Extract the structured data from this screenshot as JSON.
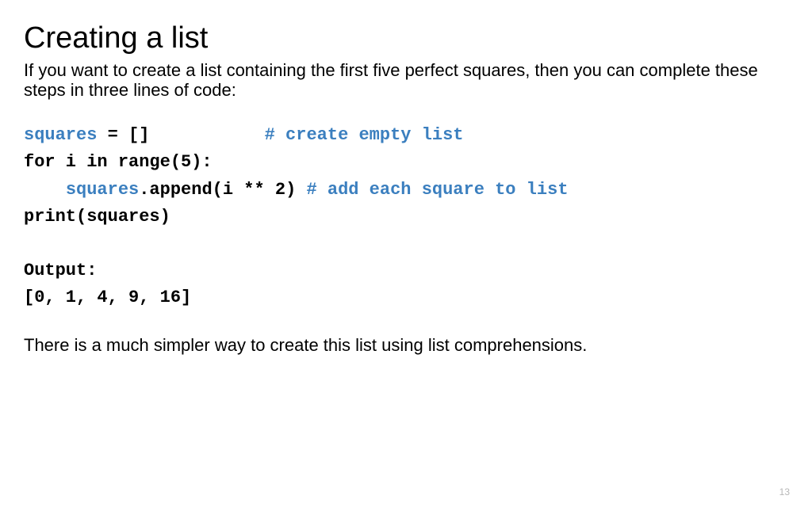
{
  "title": "Creating a list",
  "intro": "If you want to create a list containing the first five perfect squares, then you can complete these steps in three lines of code:",
  "code": {
    "l1a": "squares",
    "l1b": " = []           ",
    "l1c": "# create empty list",
    "l2": "for i in range(5):",
    "l3a": "    ",
    "l3b": "squares",
    "l3c": ".append(i ** 2) ",
    "l3d": "# add each square to list",
    "l4": "print(squares)",
    "out_label": "Output:",
    "out_value": "[0, 1, 4, 9, 16]"
  },
  "closing": "There is a much simpler way to create this list using list comprehensions.",
  "page_number": "13"
}
